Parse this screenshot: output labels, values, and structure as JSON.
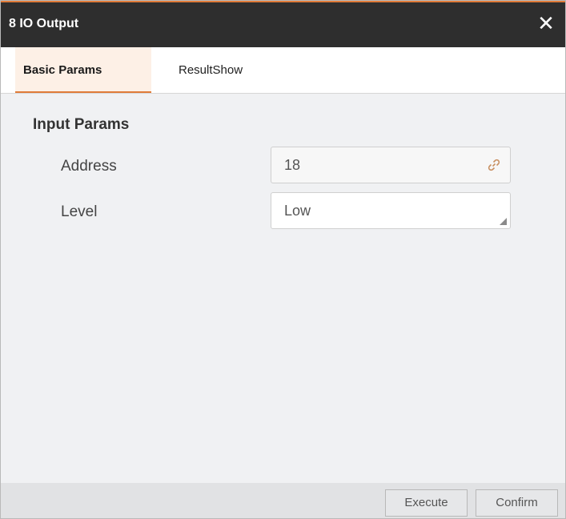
{
  "window": {
    "title": "8 IO Output",
    "close_glyph": "✕"
  },
  "tabs": [
    {
      "label": "Basic Params",
      "active": true
    },
    {
      "label": "ResultShow",
      "active": false
    }
  ],
  "section": {
    "title": "Input Params"
  },
  "params": {
    "address": {
      "label": "Address",
      "value": "18",
      "icon": "link-icon"
    },
    "level": {
      "label": "Level",
      "value": "Low",
      "icon": "resize-corner-icon"
    }
  },
  "footer": {
    "execute_label": "Execute",
    "confirm_label": "Confirm"
  },
  "colors": {
    "titlebar_bg": "#2e2e2e",
    "accent": "#e07b39",
    "content_bg": "#f0f1f3",
    "footer_bg": "#e1e2e4"
  }
}
